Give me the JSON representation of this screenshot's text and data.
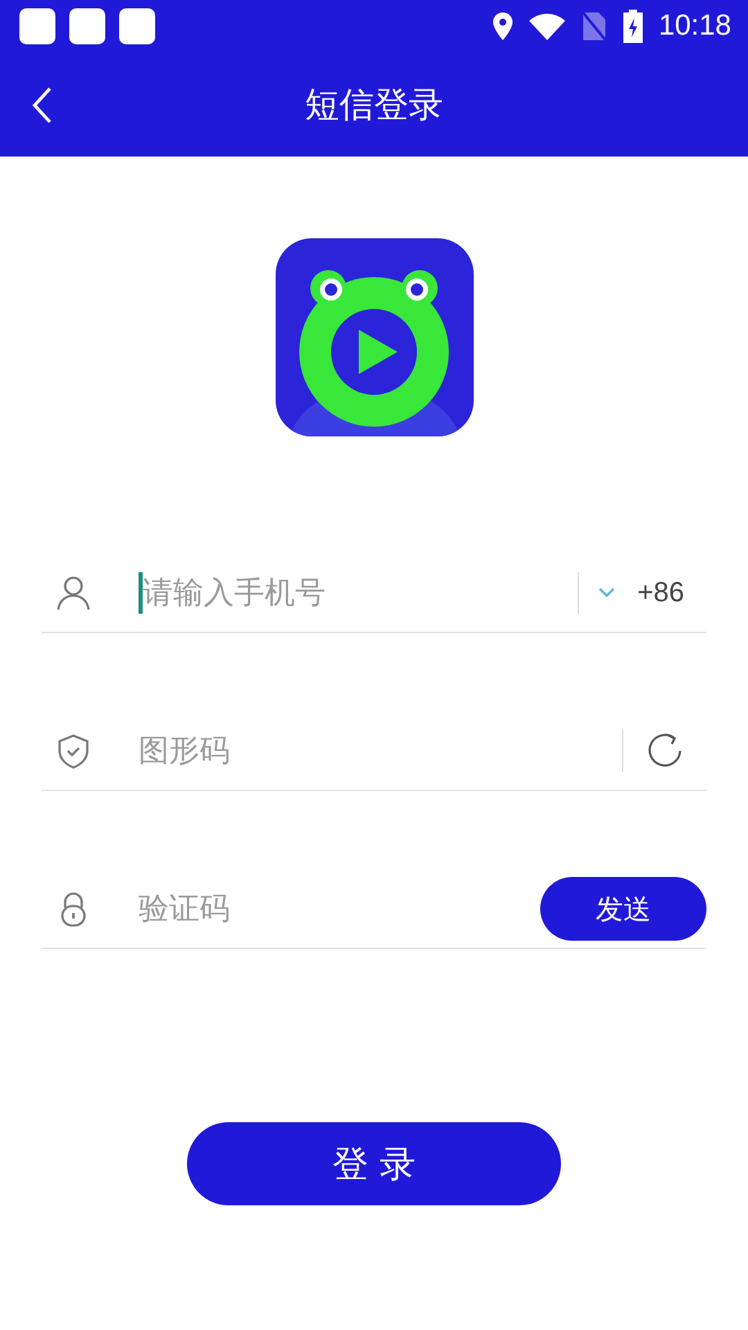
{
  "status_bar": {
    "time": "10:18"
  },
  "header": {
    "title": "短信登录"
  },
  "fields": [
    {
      "kind": "phone",
      "placeholder": "请输入手机号",
      "focused": true,
      "country_code": "+86"
    },
    {
      "kind": "captcha",
      "placeholder": "图形码",
      "focused": false
    },
    {
      "kind": "code",
      "placeholder": "验证码",
      "focused": false,
      "send_button": "发送"
    }
  ],
  "login_button": "登 录"
}
